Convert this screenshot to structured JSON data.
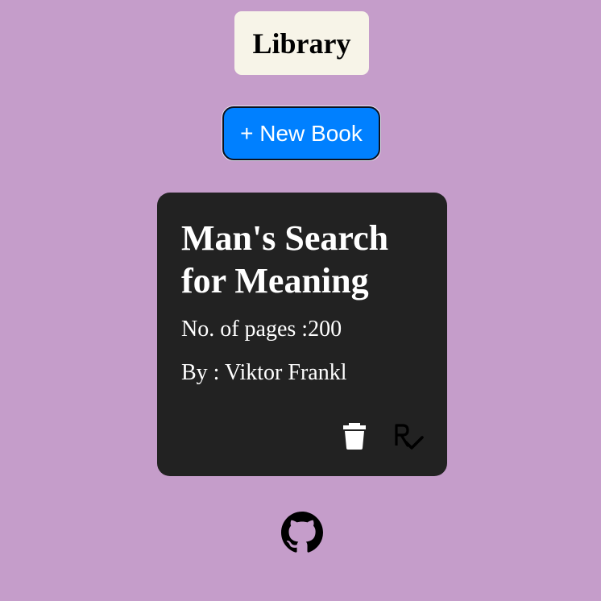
{
  "header": {
    "title": "Library"
  },
  "toolbar": {
    "new_book_label": "+ New Book"
  },
  "books": [
    {
      "title": "Man's Search for Meaning",
      "pages_text": "No. of pages :200",
      "author_text": "By : Viktor Frankl",
      "actions": {
        "delete_icon": "trash-icon",
        "read_icon": "read-status-icon"
      }
    }
  ],
  "footer": {
    "link_icon": "github-icon"
  },
  "colors": {
    "background": "#c59dca",
    "title_box": "#f7f4e8",
    "button": "#0080ff",
    "card": "#222222",
    "text_on_card": "#ffffff"
  }
}
